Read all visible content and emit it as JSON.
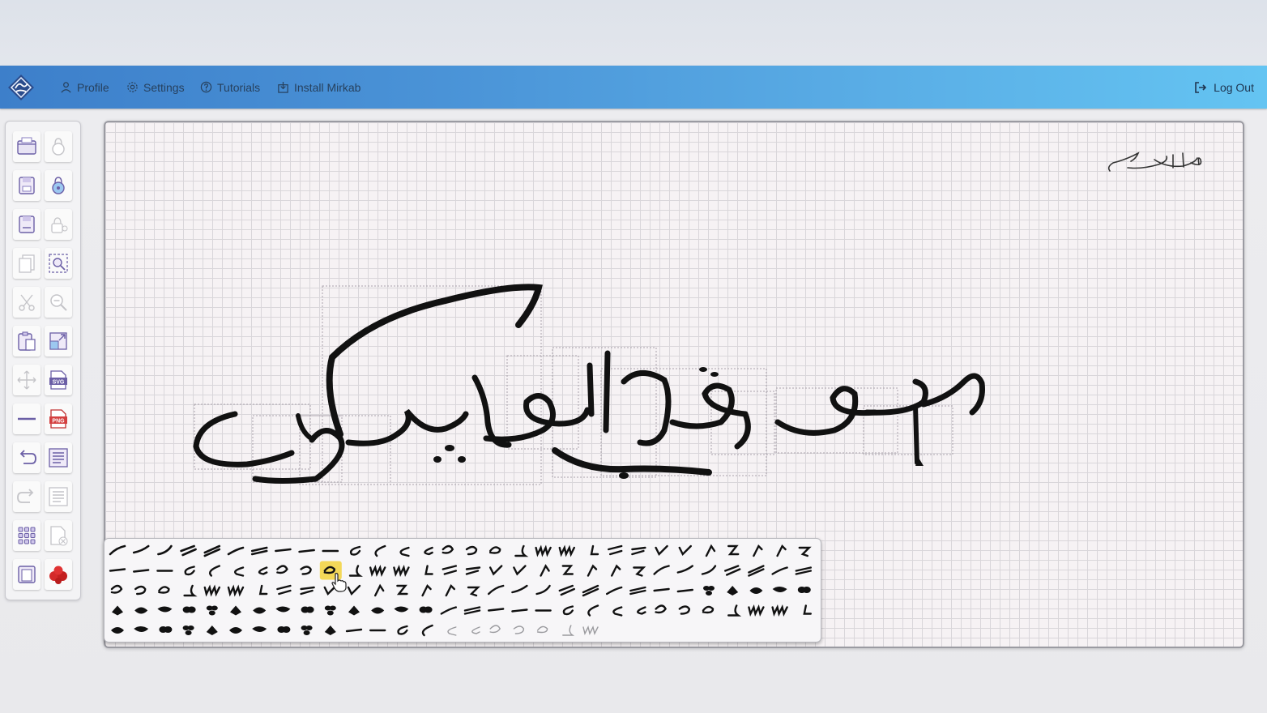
{
  "topbar": {
    "logo_icon": "mirkab-calligraphy-logo",
    "nav": [
      {
        "label": "Profile",
        "icon": "user-icon"
      },
      {
        "label": "Settings",
        "icon": "gear-icon"
      },
      {
        "label": "Tutorials",
        "icon": "help-circle-icon"
      },
      {
        "label": "Install Mirkab",
        "icon": "install-icon"
      }
    ],
    "logout_label": "Log Out"
  },
  "toolbox": {
    "left_column": [
      "open-folder-icon",
      "save-icon",
      "save-as-icon",
      "copy-icon",
      "cut-icon",
      "paste-icon",
      "move-icon",
      "line-icon",
      "undo-icon",
      "redo-icon",
      "grid-icon",
      "frame-icon"
    ],
    "right_column": [
      "lock-disabled-icon",
      "unlock-icon",
      "lock-settings-icon",
      "zoom-region-icon",
      "zoom-out-icon",
      "resize-icon",
      "svg-export-icon",
      "png-export-icon",
      "text-list-icon",
      "text-list-disabled-icon",
      "remove-page-icon",
      "color-drops-icon"
    ],
    "svg_label": "SVG",
    "png_label": "PNG"
  },
  "canvas": {
    "preview_thumbnail": "calligraphy-preview",
    "artwork": "calligraphy-artwork"
  },
  "palette": {
    "rows": 5,
    "columns": 30,
    "last_row_count": 21,
    "highlighted_index": 39
  },
  "colors": {
    "accent": "#4a93d7",
    "ink": "#111111",
    "highlight": "#f2d23c",
    "red_drops": "#d42a2a"
  }
}
